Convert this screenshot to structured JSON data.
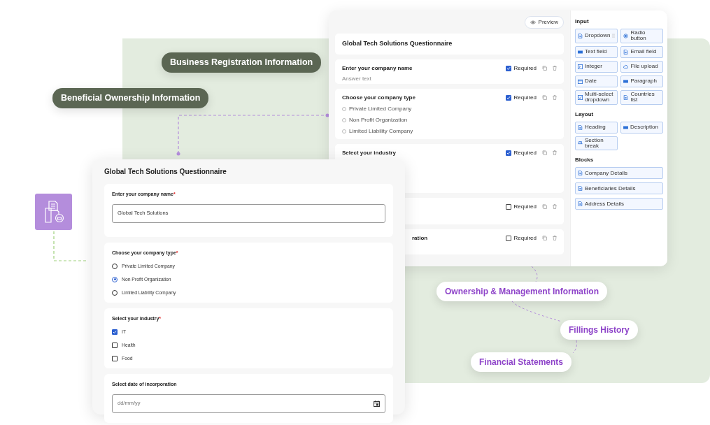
{
  "pills": [
    {
      "text": "Business Registration Information",
      "kind": "dark"
    },
    {
      "text": "Beneficial Ownership Information",
      "kind": "dark"
    },
    {
      "text": "Ownership & Management Information",
      "kind": "light"
    },
    {
      "text": "Fillings History",
      "kind": "light"
    },
    {
      "text": "Financial Statements",
      "kind": "light"
    }
  ],
  "builder": {
    "preview": "Preview",
    "title": "Global Tech Solutions Questionnaire",
    "questions": [
      {
        "label": "Enter your company name",
        "hint": "Answer text",
        "required": true,
        "required_label": "Required"
      },
      {
        "label": "Choose your company type",
        "options": [
          {
            "label": "Private Limited Company",
            "selected": false
          },
          {
            "label": "Non Profit Organization",
            "selected": false
          },
          {
            "label": "Limited Liability Company",
            "selected": false
          }
        ],
        "required": true,
        "required_label": "Required"
      },
      {
        "label": "Select your industry",
        "required": true,
        "required_label": "Required"
      },
      {
        "required": false,
        "required_label": "Required"
      },
      {
        "label": "ration",
        "kind": "covered",
        "required": false,
        "required_label": "Required"
      }
    ]
  },
  "palette": [
    {
      "heading": "Input",
      "kind": "grid",
      "items": [
        {
          "label": "Dropdown",
          "kind": "doc",
          "handle": true
        },
        {
          "label": "Radio button",
          "kind": "radio"
        },
        {
          "label": "Text field",
          "kind": "bar"
        },
        {
          "label": "Email field",
          "kind": "doc"
        },
        {
          "label": "Integer",
          "kind": "number"
        },
        {
          "label": "File upload",
          "kind": "cloud"
        },
        {
          "label": "Date",
          "kind": "cal"
        },
        {
          "label": "Paragraph",
          "kind": "bar"
        },
        {
          "label": "Multi-select dropdown",
          "kind": "check"
        },
        {
          "label": "Countries list",
          "kind": "doc"
        }
      ]
    },
    {
      "heading": "Layout",
      "kind": "grid",
      "items": [
        {
          "label": "Heading",
          "kind": "doc"
        },
        {
          "label": "Description",
          "kind": "bar"
        },
        {
          "label": "Section break",
          "kind": "break"
        }
      ]
    },
    {
      "heading": "Blocks",
      "kind": "list",
      "items": [
        {
          "label": "Company Details",
          "kind": "doc"
        },
        {
          "label": "Beneficiaries Details",
          "kind": "doc"
        },
        {
          "label": "Address Details",
          "kind": "doc"
        }
      ]
    }
  ],
  "form": {
    "title": "Global Tech Solutions Questionnaire",
    "fields": [
      {
        "kind": "text",
        "label": "Enter your company name",
        "mark": "*",
        "value": "Global Tech Solutions"
      },
      {
        "kind": "radio",
        "label": "Choose your company type",
        "mark": "*",
        "options": [
          {
            "label": "Private Limited Company",
            "selected": false
          },
          {
            "label": "Non Profit Organization",
            "selected": true
          },
          {
            "label": "Limited Liability Company",
            "selected": false
          }
        ]
      },
      {
        "kind": "checkbox",
        "label": "Select your industry",
        "mark": "*",
        "options": [
          {
            "label": "IT",
            "checked": true
          },
          {
            "label": "Health",
            "checked": false
          },
          {
            "label": "Food",
            "checked": false
          }
        ]
      },
      {
        "kind": "date",
        "label": "Select date of incorporation",
        "placeholder": "dd/mm/yy"
      }
    ]
  }
}
